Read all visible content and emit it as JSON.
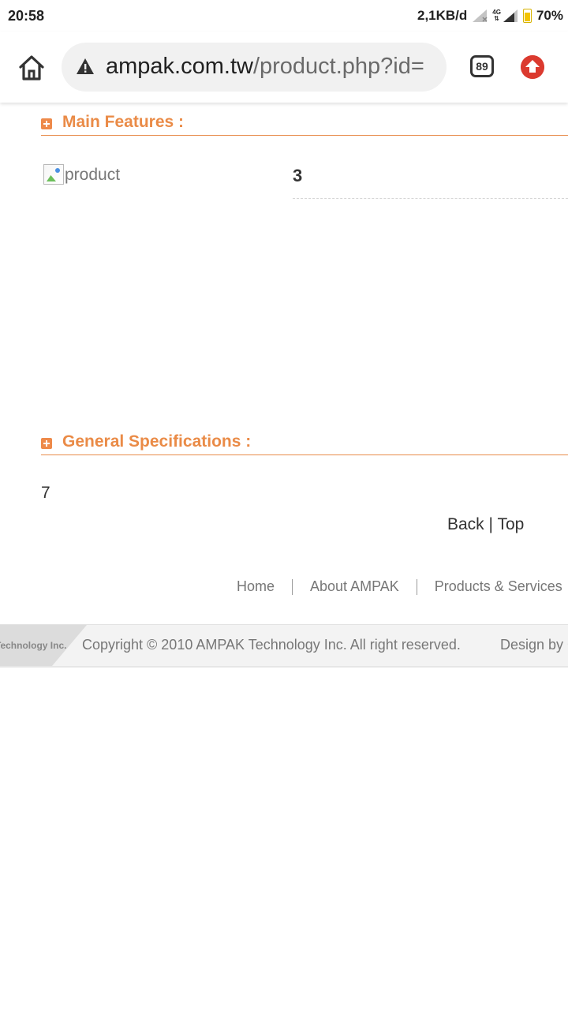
{
  "status_bar": {
    "time": "20:58",
    "data_rate": "2,1KB/d",
    "network_label": "4G",
    "battery": "70%"
  },
  "browser": {
    "url_host": "ampak.com.tw",
    "url_path": "/product.php?id=",
    "tab_count": "89"
  },
  "main_features": {
    "title": "Main Features :",
    "image_alt": "product",
    "value": "3"
  },
  "general_specs": {
    "title": "General Specifications :",
    "value": "7"
  },
  "links": {
    "back": "Back",
    "separator": " | ",
    "top": "Top"
  },
  "footer_nav": {
    "items": [
      "Home",
      "About AMPAK",
      "Products & Services"
    ]
  },
  "footer": {
    "logo_text": "Technology Inc.",
    "copyright": "Copyright © 2010 AMPAK Technology Inc. All right reserved.",
    "design_by": "Design by CH"
  },
  "colors": {
    "accent": "#ea8b47",
    "update_button": "#db3a2f"
  }
}
